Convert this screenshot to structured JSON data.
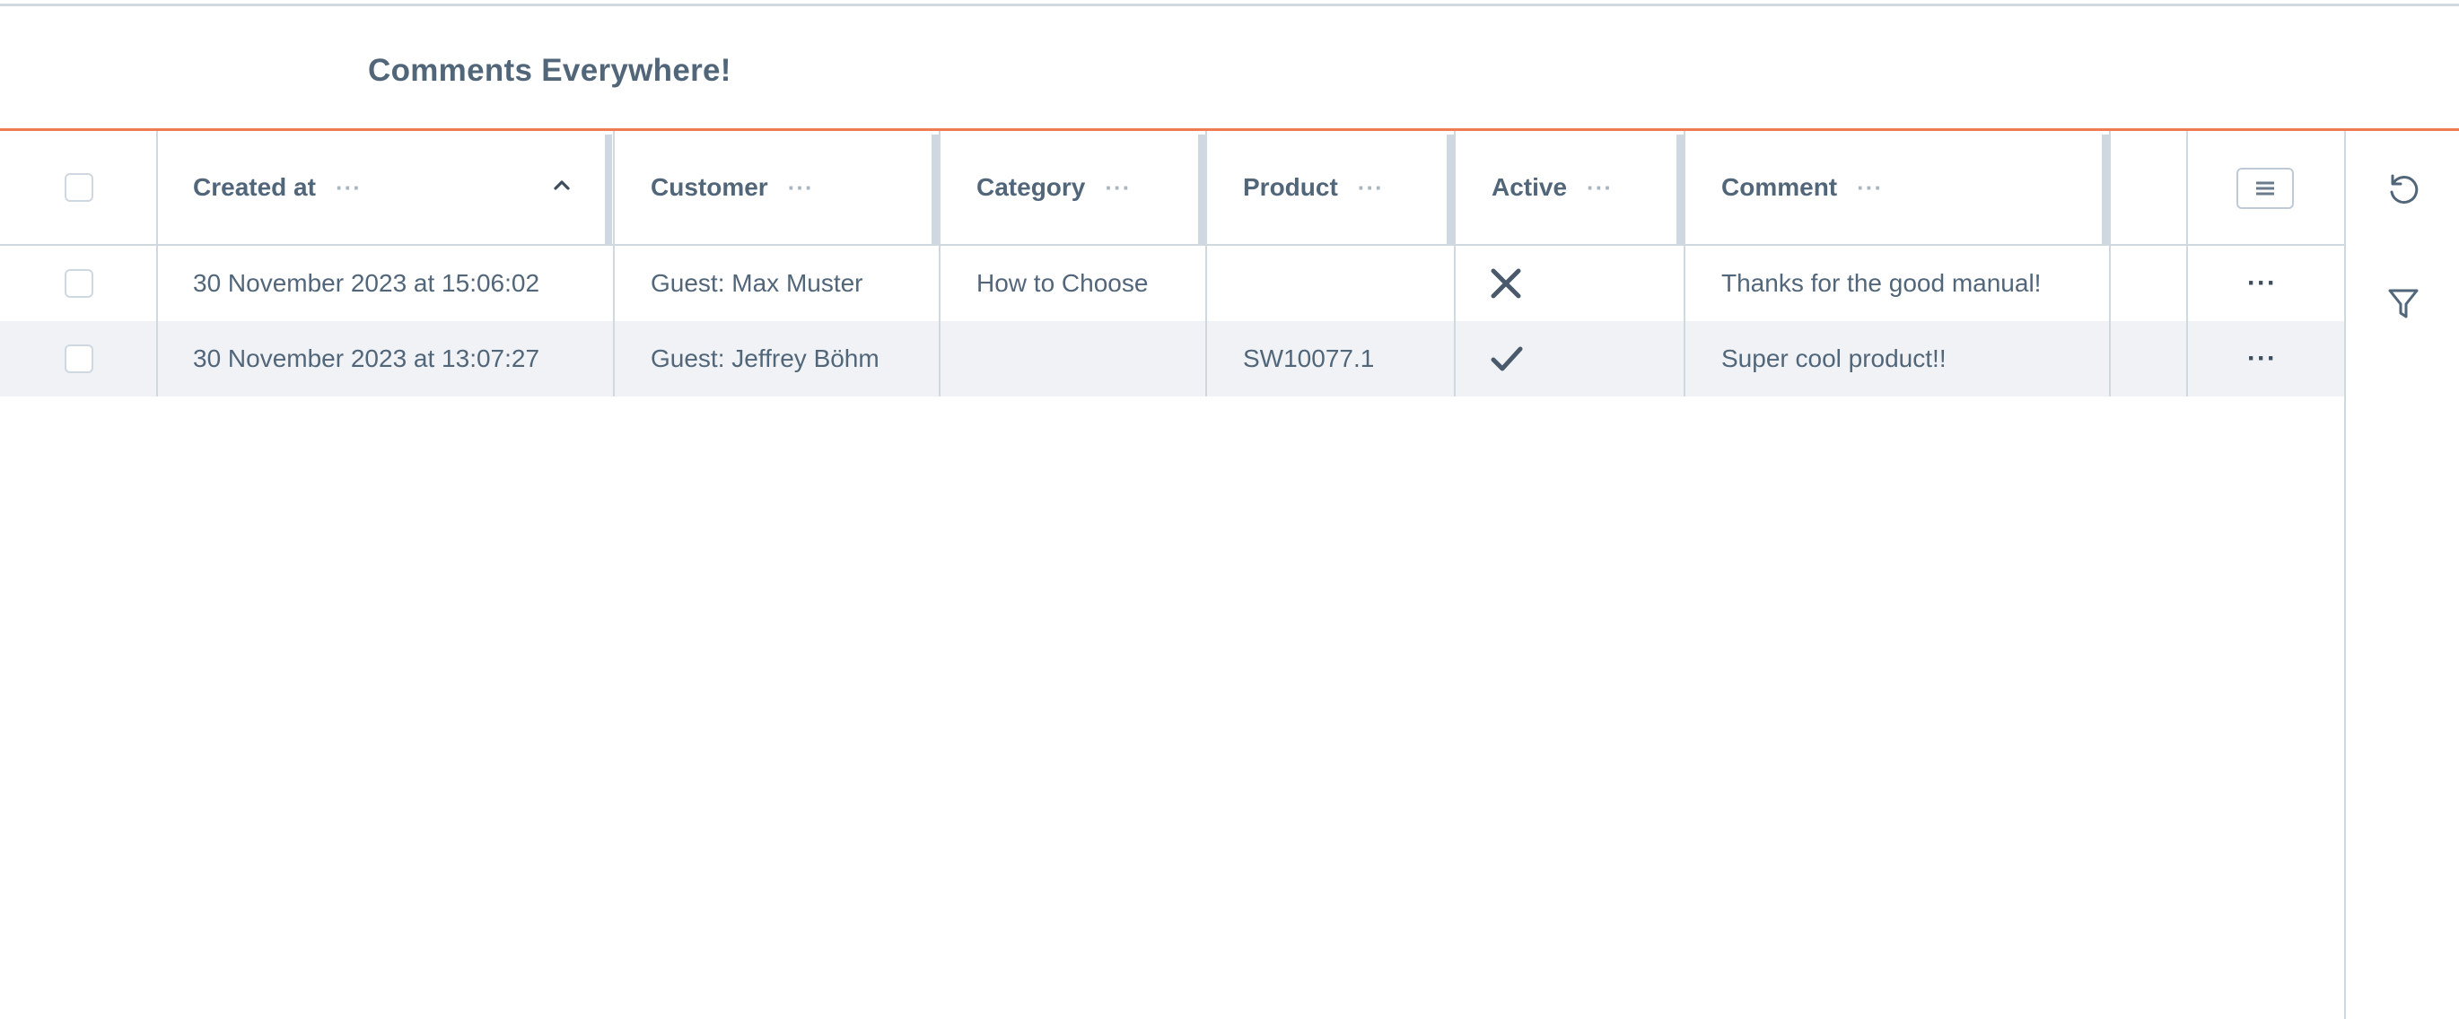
{
  "page": {
    "title": "Comments Everywhere!"
  },
  "grid": {
    "columns": [
      {
        "key": "created_at",
        "label": "Created at",
        "sort": "ascending"
      },
      {
        "key": "customer",
        "label": "Customer"
      },
      {
        "key": "category",
        "label": "Category"
      },
      {
        "key": "product",
        "label": "Product"
      },
      {
        "key": "active",
        "label": "Active"
      },
      {
        "key": "comment",
        "label": "Comment"
      }
    ],
    "context_dots": "···",
    "rows": [
      {
        "created_at": "30 November 2023 at 15:06:02",
        "customer": "Guest: Max Muster",
        "category": "How to Choose",
        "product": "",
        "active": false,
        "active_icon": "x-icon",
        "comment": "Thanks for the good manual!",
        "menu": "···"
      },
      {
        "created_at": "30 November 2023 at 13:07:27",
        "customer": "Guest: Jeffrey Böhm",
        "category": "",
        "product": "SW10077.1",
        "active": true,
        "active_icon": "checkmark-icon",
        "comment": "Super cool product!!",
        "menu": "···"
      }
    ]
  },
  "sidebar": {
    "items": [
      {
        "icon": "refresh-icon"
      },
      {
        "icon": "filter-icon"
      }
    ]
  },
  "colors": {
    "accent": "#f07b52",
    "text": "#52667a",
    "border": "#d1d9e0",
    "row_alt": "#f0f2f5"
  }
}
